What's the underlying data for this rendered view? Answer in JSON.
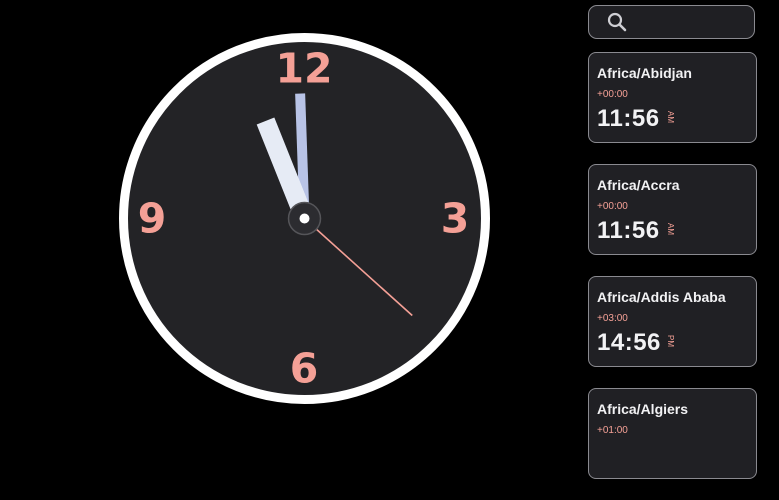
{
  "clock": {
    "numerals": {
      "twelve": "12",
      "three": "3",
      "six": "6",
      "nine": "9"
    },
    "time": {
      "hour": 11,
      "minute": 56,
      "second": 22
    },
    "colors": {
      "face": "#232326",
      "rim": "#ffffff",
      "numerals": "#f4a096",
      "hour_hand": "#b8c3e6",
      "minute_hand": "#e6ebf5",
      "second_hand": "#f4a096"
    }
  },
  "search": {
    "icon": "search-icon",
    "placeholder": "",
    "value": ""
  },
  "zones": [
    {
      "name": "Africa/Abidjan",
      "offset": "+00:00",
      "time": "11:56",
      "ampm": "AM"
    },
    {
      "name": "Africa/Accra",
      "offset": "+00:00",
      "time": "11:56",
      "ampm": "AM"
    },
    {
      "name": "Africa/Addis Ababa",
      "offset": "+03:00",
      "time": "14:56",
      "ampm": "PM"
    },
    {
      "name": "Africa/Algiers",
      "offset": "+01:00",
      "time": "",
      "ampm": ""
    }
  ]
}
